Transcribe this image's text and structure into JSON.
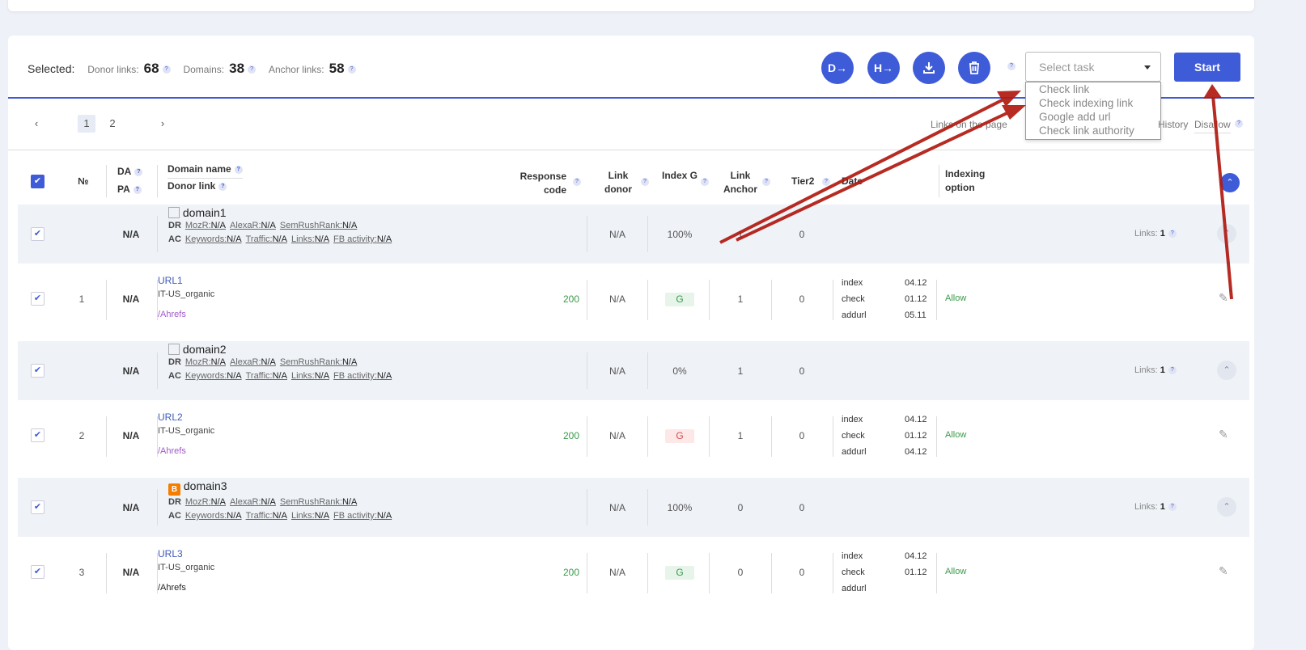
{
  "selected": {
    "label": "Selected:",
    "donor_links_label": "Donor links:",
    "donor_links": "68",
    "domains_label": "Domains:",
    "domains": "38",
    "anchor_links_label": "Anchor links:",
    "anchor_links": "58"
  },
  "toolbar": {
    "btn_d": "D→",
    "btn_h": "H→",
    "select_placeholder": "Select task",
    "start": "Start",
    "accent": "#3e5bd8"
  },
  "task_options": [
    "Check link",
    "Check indexing link",
    "Google add url",
    "Check link authority"
  ],
  "pagination": {
    "prev": "‹",
    "pages": [
      "1",
      "2"
    ],
    "current": "1",
    "next": "›"
  },
  "filters": {
    "links_on_page": "Links on the page",
    "history": "History",
    "disallow": "Disallow"
  },
  "headers": {
    "no": "№",
    "da": "DA",
    "pa": "PA",
    "domain_name": "Domain name",
    "donor_link": "Donor link",
    "response_code": "Response code",
    "link_donor": "Link donor",
    "index_g": "Index G",
    "link_anchor": "Link Anchor",
    "tier2": "Tier2",
    "date": "Date",
    "indexing_option": "Indexing option"
  },
  "groups": [
    {
      "domain": "domain1",
      "icon": "image-icon",
      "da": "N/A",
      "link_donor": "N/A",
      "index": "100%",
      "anchor": "1",
      "tier2": "0",
      "links_label": "Links:",
      "links": "1",
      "dr": {
        "label": "DR",
        "items": [
          [
            "MozR:",
            "N/A"
          ],
          [
            "AlexaR:",
            "N/A"
          ],
          [
            "SemRushRank:",
            "N/A"
          ]
        ]
      },
      "ac": {
        "label": "AC",
        "items": [
          [
            "Keywords:",
            "N/A"
          ],
          [
            "Traffic:",
            "N/A"
          ],
          [
            "Links:",
            "N/A"
          ],
          [
            "FB activity:",
            "N/A"
          ]
        ]
      },
      "row": {
        "no": "1",
        "da": "N/A",
        "url": "URL1",
        "tag": "IT-US_organic",
        "source": "/Ahrefs",
        "source_color": "#a05bc8",
        "code": "200",
        "link_donor": "N/A",
        "g": "G",
        "g_status": "indexed",
        "anchor": "1",
        "tier2": "0",
        "dates": [
          [
            "index",
            "04.12"
          ],
          [
            "check",
            "01.12"
          ],
          [
            "addurl",
            "05.11"
          ]
        ],
        "option": "Allow"
      }
    },
    {
      "domain": "domain2",
      "icon": "image-icon",
      "da": "N/A",
      "link_donor": "N/A",
      "index": "0%",
      "anchor": "1",
      "tier2": "0",
      "links_label": "Links:",
      "links": "1",
      "dr": {
        "label": "DR",
        "items": [
          [
            "MozR:",
            "N/A"
          ],
          [
            "AlexaR:",
            "N/A"
          ],
          [
            "SemRushRank:",
            "N/A"
          ]
        ]
      },
      "ac": {
        "label": "AC",
        "items": [
          [
            "Keywords:",
            "N/A"
          ],
          [
            "Traffic:",
            "N/A"
          ],
          [
            "Links:",
            "N/A"
          ],
          [
            "FB activity:",
            "N/A"
          ]
        ]
      },
      "row": {
        "no": "2",
        "da": "N/A",
        "url": "URL2",
        "tag": "IT-US_organic",
        "source": "/Ahrefs",
        "source_color": "#a05bc8",
        "code": "200",
        "link_donor": "N/A",
        "g": "G",
        "g_status": "not-indexed",
        "anchor": "1",
        "tier2": "0",
        "dates": [
          [
            "index",
            "04.12"
          ],
          [
            "check",
            "01.12"
          ],
          [
            "addurl",
            "04.12"
          ]
        ],
        "option": "Allow"
      }
    },
    {
      "domain": "domain3",
      "icon": "blogger-icon",
      "da": "N/A",
      "link_donor": "N/A",
      "index": "100%",
      "anchor": "0",
      "tier2": "0",
      "links_label": "Links:",
      "links": "1",
      "dr": {
        "label": "DR",
        "items": [
          [
            "MozR:",
            "N/A"
          ],
          [
            "AlexaR:",
            "N/A"
          ],
          [
            "SemRushRank:",
            "N/A"
          ]
        ]
      },
      "ac": {
        "label": "AC",
        "items": [
          [
            "Keywords:",
            "N/A"
          ],
          [
            "Traffic:",
            "N/A"
          ],
          [
            "Links:",
            "N/A"
          ],
          [
            "FB activity:",
            "N/A"
          ]
        ]
      },
      "row": {
        "no": "3",
        "da": "N/A",
        "url": "URL3",
        "tag": "IT-US_organic",
        "source": "/Ahrefs",
        "source_color": "#222222",
        "code": "200",
        "link_donor": "N/A",
        "g": "G",
        "g_status": "indexed",
        "anchor": "0",
        "tier2": "0",
        "dates": [
          [
            "index",
            "04.12"
          ],
          [
            "check",
            "01.12"
          ],
          [
            "addurl",
            ""
          ]
        ],
        "option": "Allow"
      }
    }
  ]
}
